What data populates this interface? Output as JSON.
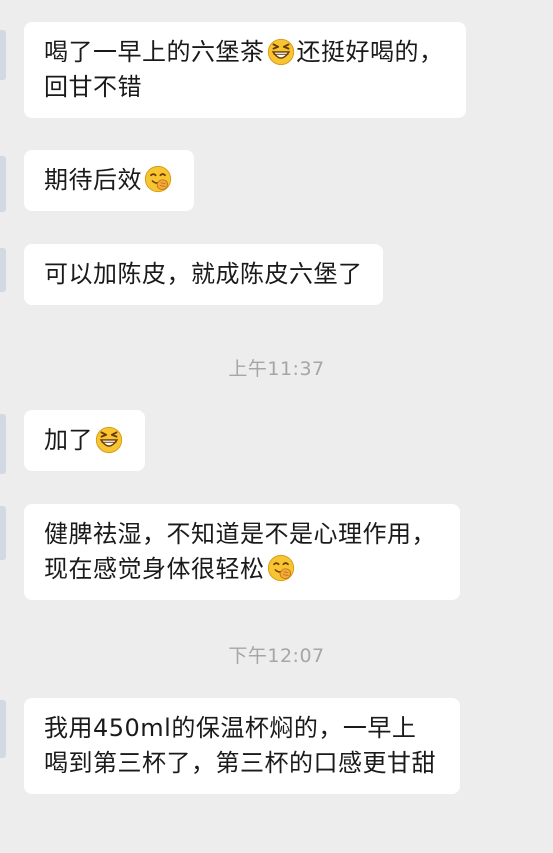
{
  "messages": [
    {
      "parts": [
        "喝了一早上的六堡茶",
        "还挺好喝的，回甘不错"
      ],
      "emojis": [
        "grin-emoji"
      ]
    },
    {
      "parts": [
        "期待后效",
        ""
      ],
      "emojis": [
        "chuckle-emoji"
      ]
    },
    {
      "parts": [
        "可以加陈皮，就成陈皮六堡了"
      ],
      "emojis": []
    },
    {
      "parts": [
        "加了",
        ""
      ],
      "emojis": [
        "grin-emoji"
      ]
    },
    {
      "parts": [
        "健脾祛湿，不知道是不是心理作用，现在感觉身体很轻松",
        ""
      ],
      "emojis": [
        "chuckle-emoji"
      ]
    },
    {
      "parts": [
        "我用450ml的保温杯焖的，一早上喝到第三杯了，第三杯的口感更甘甜"
      ],
      "emojis": []
    }
  ],
  "timestamps": [
    "上午11:37",
    "下午12:07"
  ]
}
